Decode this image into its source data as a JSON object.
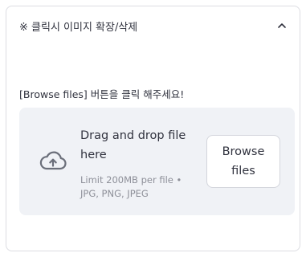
{
  "expander": {
    "title": "※ 클릭시 이미지 확장/삭제",
    "toggle_icon": "chevron-up-icon"
  },
  "uploader": {
    "instruction": "[Browse files] 버튼을 클릭 해주세요!",
    "upload_icon": "cloud-upload-icon",
    "drop_title": "Drag and drop file here",
    "limit_text": "Limit 200MB per file • JPG, PNG, JPEG",
    "browse_label": "Browse files"
  },
  "colors": {
    "text": "#31333f",
    "muted": "#8e9099",
    "dropzone_bg": "#f0f2f6",
    "border": "#dcdde2",
    "icon": "#6b6f7a"
  }
}
